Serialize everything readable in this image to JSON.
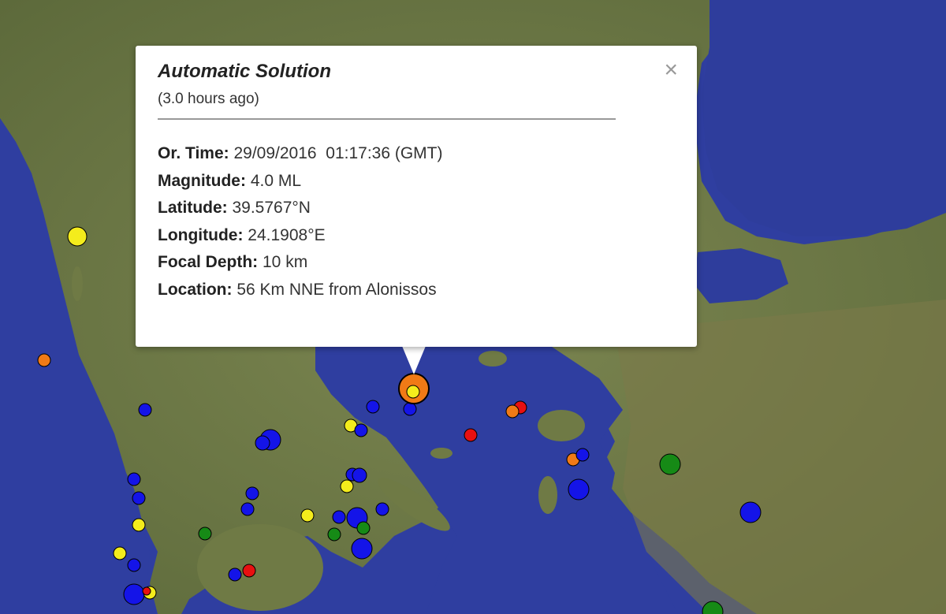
{
  "popup": {
    "title": "Automatic Solution",
    "age": "(3.0 hours ago)",
    "close_symbol": "×",
    "fields": [
      {
        "label": "Or. Time:",
        "value": " 29/09/2016  01:17:36 (GMT)"
      },
      {
        "label": "Magnitude:",
        "value": " 4.0 ML"
      },
      {
        "label": "Latitude:",
        "value": " 39.5767°N"
      },
      {
        "label": "Longitude:",
        "value": " 24.1908°E"
      },
      {
        "label": "Focal Depth:",
        "value": " 10 km"
      },
      {
        "label": "Location:",
        "value": " 56 Km NNE from Alonissos"
      }
    ]
  },
  "marker_colors": {
    "yellow": "#f4ec1c",
    "orange": "#f07a16",
    "red": "#e81010",
    "blue": "#1414e8",
    "green": "#168a16",
    "selected": "#f07a16"
  },
  "map_colors": {
    "sea": "#2f3ea0",
    "land": "#6f7a45"
  }
}
